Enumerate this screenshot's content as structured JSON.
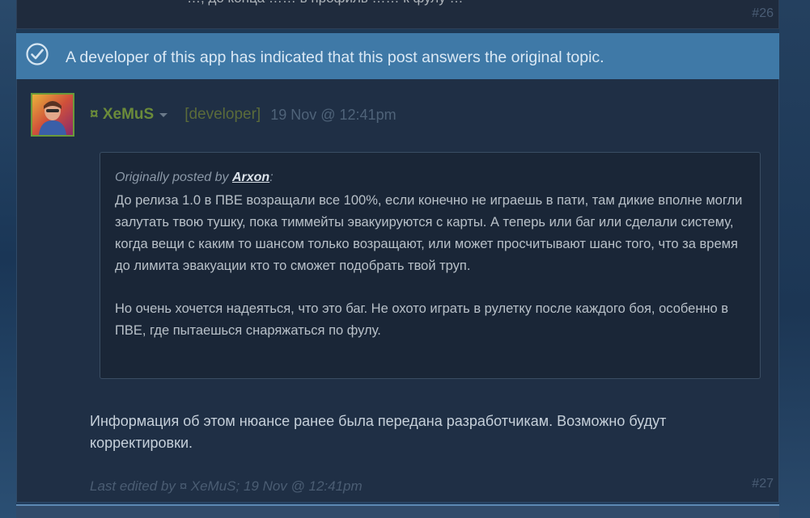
{
  "prev_post": {
    "cut_text": "…, до конца …… в профиль …… к фулу …",
    "number": "#26"
  },
  "answer_banner": {
    "text": "A developer of this app has indicated that this post answers the original topic."
  },
  "post": {
    "author": "¤ XeMuS",
    "role": "[developer]",
    "timestamp": "19 Nov @ 12:41pm",
    "quote": {
      "prefix": "Originally posted by ",
      "author": "Arxon",
      "suffix": ":",
      "paragraph1": "До релиза 1.0 в ПВЕ возращали все 100%, если конечно не играешь в пати, там дикие вполне могли залутать твою тушку, пока тиммейты эвакуируются с карты. А теперь или баг или сделали систему, когда вещи с каким то шансом только возращают, или может просчитывают шанс того, что за время до лимита эвакуации кто то сможет подобрать твой труп.",
      "paragraph2": "Но очень хочется надеяться, что это баг. Не охото играть в рулетку после каждого боя, особенно в ПВЕ, где пытаешься снаряжаться по фулу."
    },
    "reply": "Информация об этом нюансе ранее была передана разработчикам. Возможно будут корректировки.",
    "edited": "Last edited by ¤ XeMuS; 19 Nov @ 12:41pm",
    "number": "#27"
  },
  "icons": {
    "check": "check-circle-icon",
    "dropdown": "chevron-down-icon"
  },
  "colors": {
    "banner": "#3f79a7",
    "post_bg": "#1f2f45",
    "author": "#6b8b3a"
  }
}
